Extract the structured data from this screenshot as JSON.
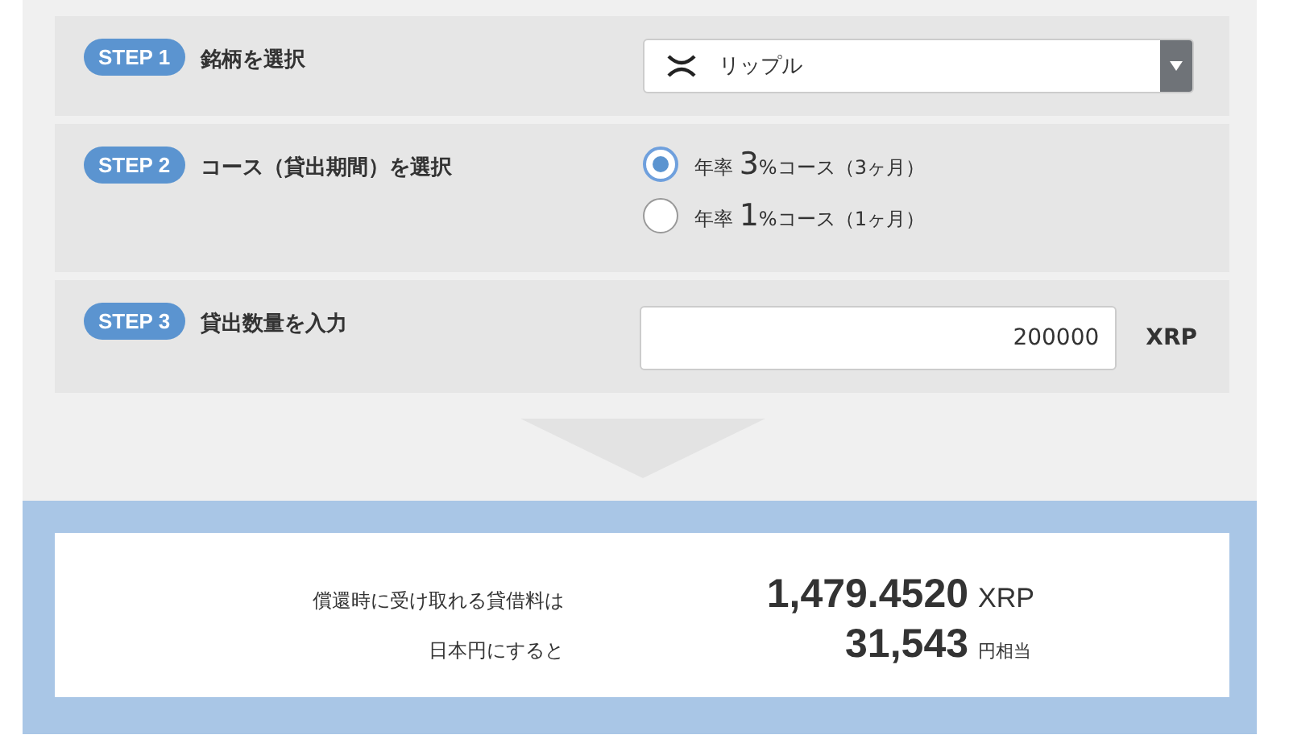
{
  "steps": [
    {
      "kind": "select",
      "badge": "STEP 1",
      "label": "銘柄を選択",
      "value": "リップル"
    },
    {
      "kind": "radio",
      "badge": "STEP 2",
      "label": "コース（貸出期間）を選択",
      "options": [
        {
          "prefix": "年率",
          "rate": "3",
          "suffix": "%コース（3ヶ月）",
          "selected": true
        },
        {
          "prefix": "年率",
          "rate": "1",
          "suffix": "%コース（1ヶ月）",
          "selected": false
        }
      ]
    },
    {
      "kind": "input",
      "badge": "STEP 3",
      "label": "貸出数量を入力",
      "value": "200000",
      "unit": "XRP"
    }
  ],
  "result": [
    {
      "label": "償還時に受け取れる貸借料は",
      "value": "1,479.4520",
      "unit": "XRP",
      "kind": "large"
    },
    {
      "label": "日本円にすると",
      "value": "31,543",
      "unit": "円相当",
      "kind": "small"
    }
  ]
}
